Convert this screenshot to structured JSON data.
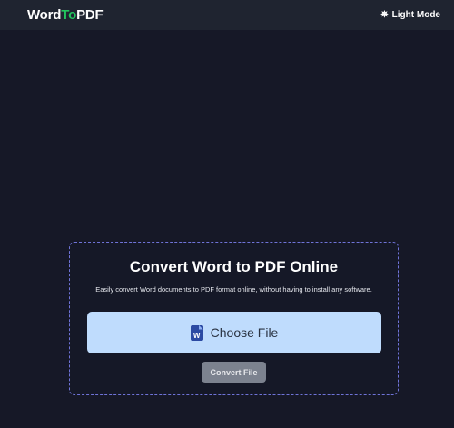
{
  "header": {
    "logo_part1": "Word",
    "logo_part2": "To",
    "logo_part3": "PDF",
    "mode_toggle_label": "Light Mode"
  },
  "converter": {
    "title": "Convert Word to PDF Online",
    "subtitle": "Easily convert Word documents to PDF format online, without having to install any software.",
    "choose_file_label": "Choose File",
    "file_icon_letter": "W",
    "convert_button_label": "Convert File"
  },
  "icons": {
    "mode_toggle": "sun-icon",
    "file": "word-document-icon"
  },
  "colors": {
    "background": "#161827",
    "topbar": "#1f2430",
    "accent": "#22c55e",
    "card_border": "#6f73d8",
    "choose_file_bg": "#bfdcfd",
    "convert_button_bg": "#7c828f"
  }
}
